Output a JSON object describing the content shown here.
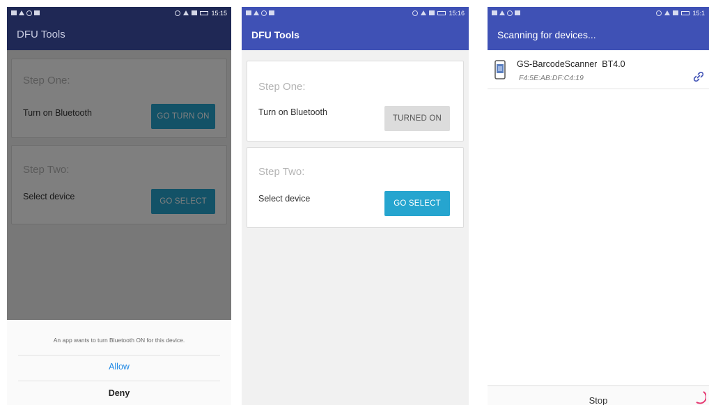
{
  "screen1": {
    "status_time": "15:15",
    "app_title": "DFU Tools",
    "step_one": {
      "title": "Step One:",
      "text": "Turn on Bluetooth",
      "button": "GO TURN ON"
    },
    "step_two": {
      "title": "Step Two:",
      "text": "Select device",
      "button": "GO SELECT"
    },
    "dialog": {
      "message": "An app wants to turn Bluetooth ON for this device.",
      "allow": "Allow",
      "deny": "Deny"
    }
  },
  "screen2": {
    "status_time": "15:16",
    "app_title": "DFU Tools",
    "step_one": {
      "title": "Step One:",
      "text": "Turn on Bluetooth",
      "button": "TURNED ON"
    },
    "step_two": {
      "title": "Step Two:",
      "text": "Select device",
      "button": "GO SELECT"
    }
  },
  "screen3": {
    "status_time": "15:1",
    "app_title": "Scanning for devices...",
    "device": {
      "name": "GS-BarcodeScanner  BT4.0",
      "address": "F4:5E:AB:DF:C4:19"
    },
    "stop_button": "Stop"
  },
  "colors": {
    "app_bar": "#3f51b5",
    "app_bar_dimmed": "#1f2855",
    "button_blue": "#26a5cf",
    "button_disabled": "#dcdcdc",
    "link_icon": "#3f51b5",
    "allow_text": "#1e88e5"
  },
  "icons": [
    "phone-device-icon",
    "link-icon",
    "wifi-icon",
    "signal-icon",
    "battery-icon",
    "alarm-icon"
  ]
}
